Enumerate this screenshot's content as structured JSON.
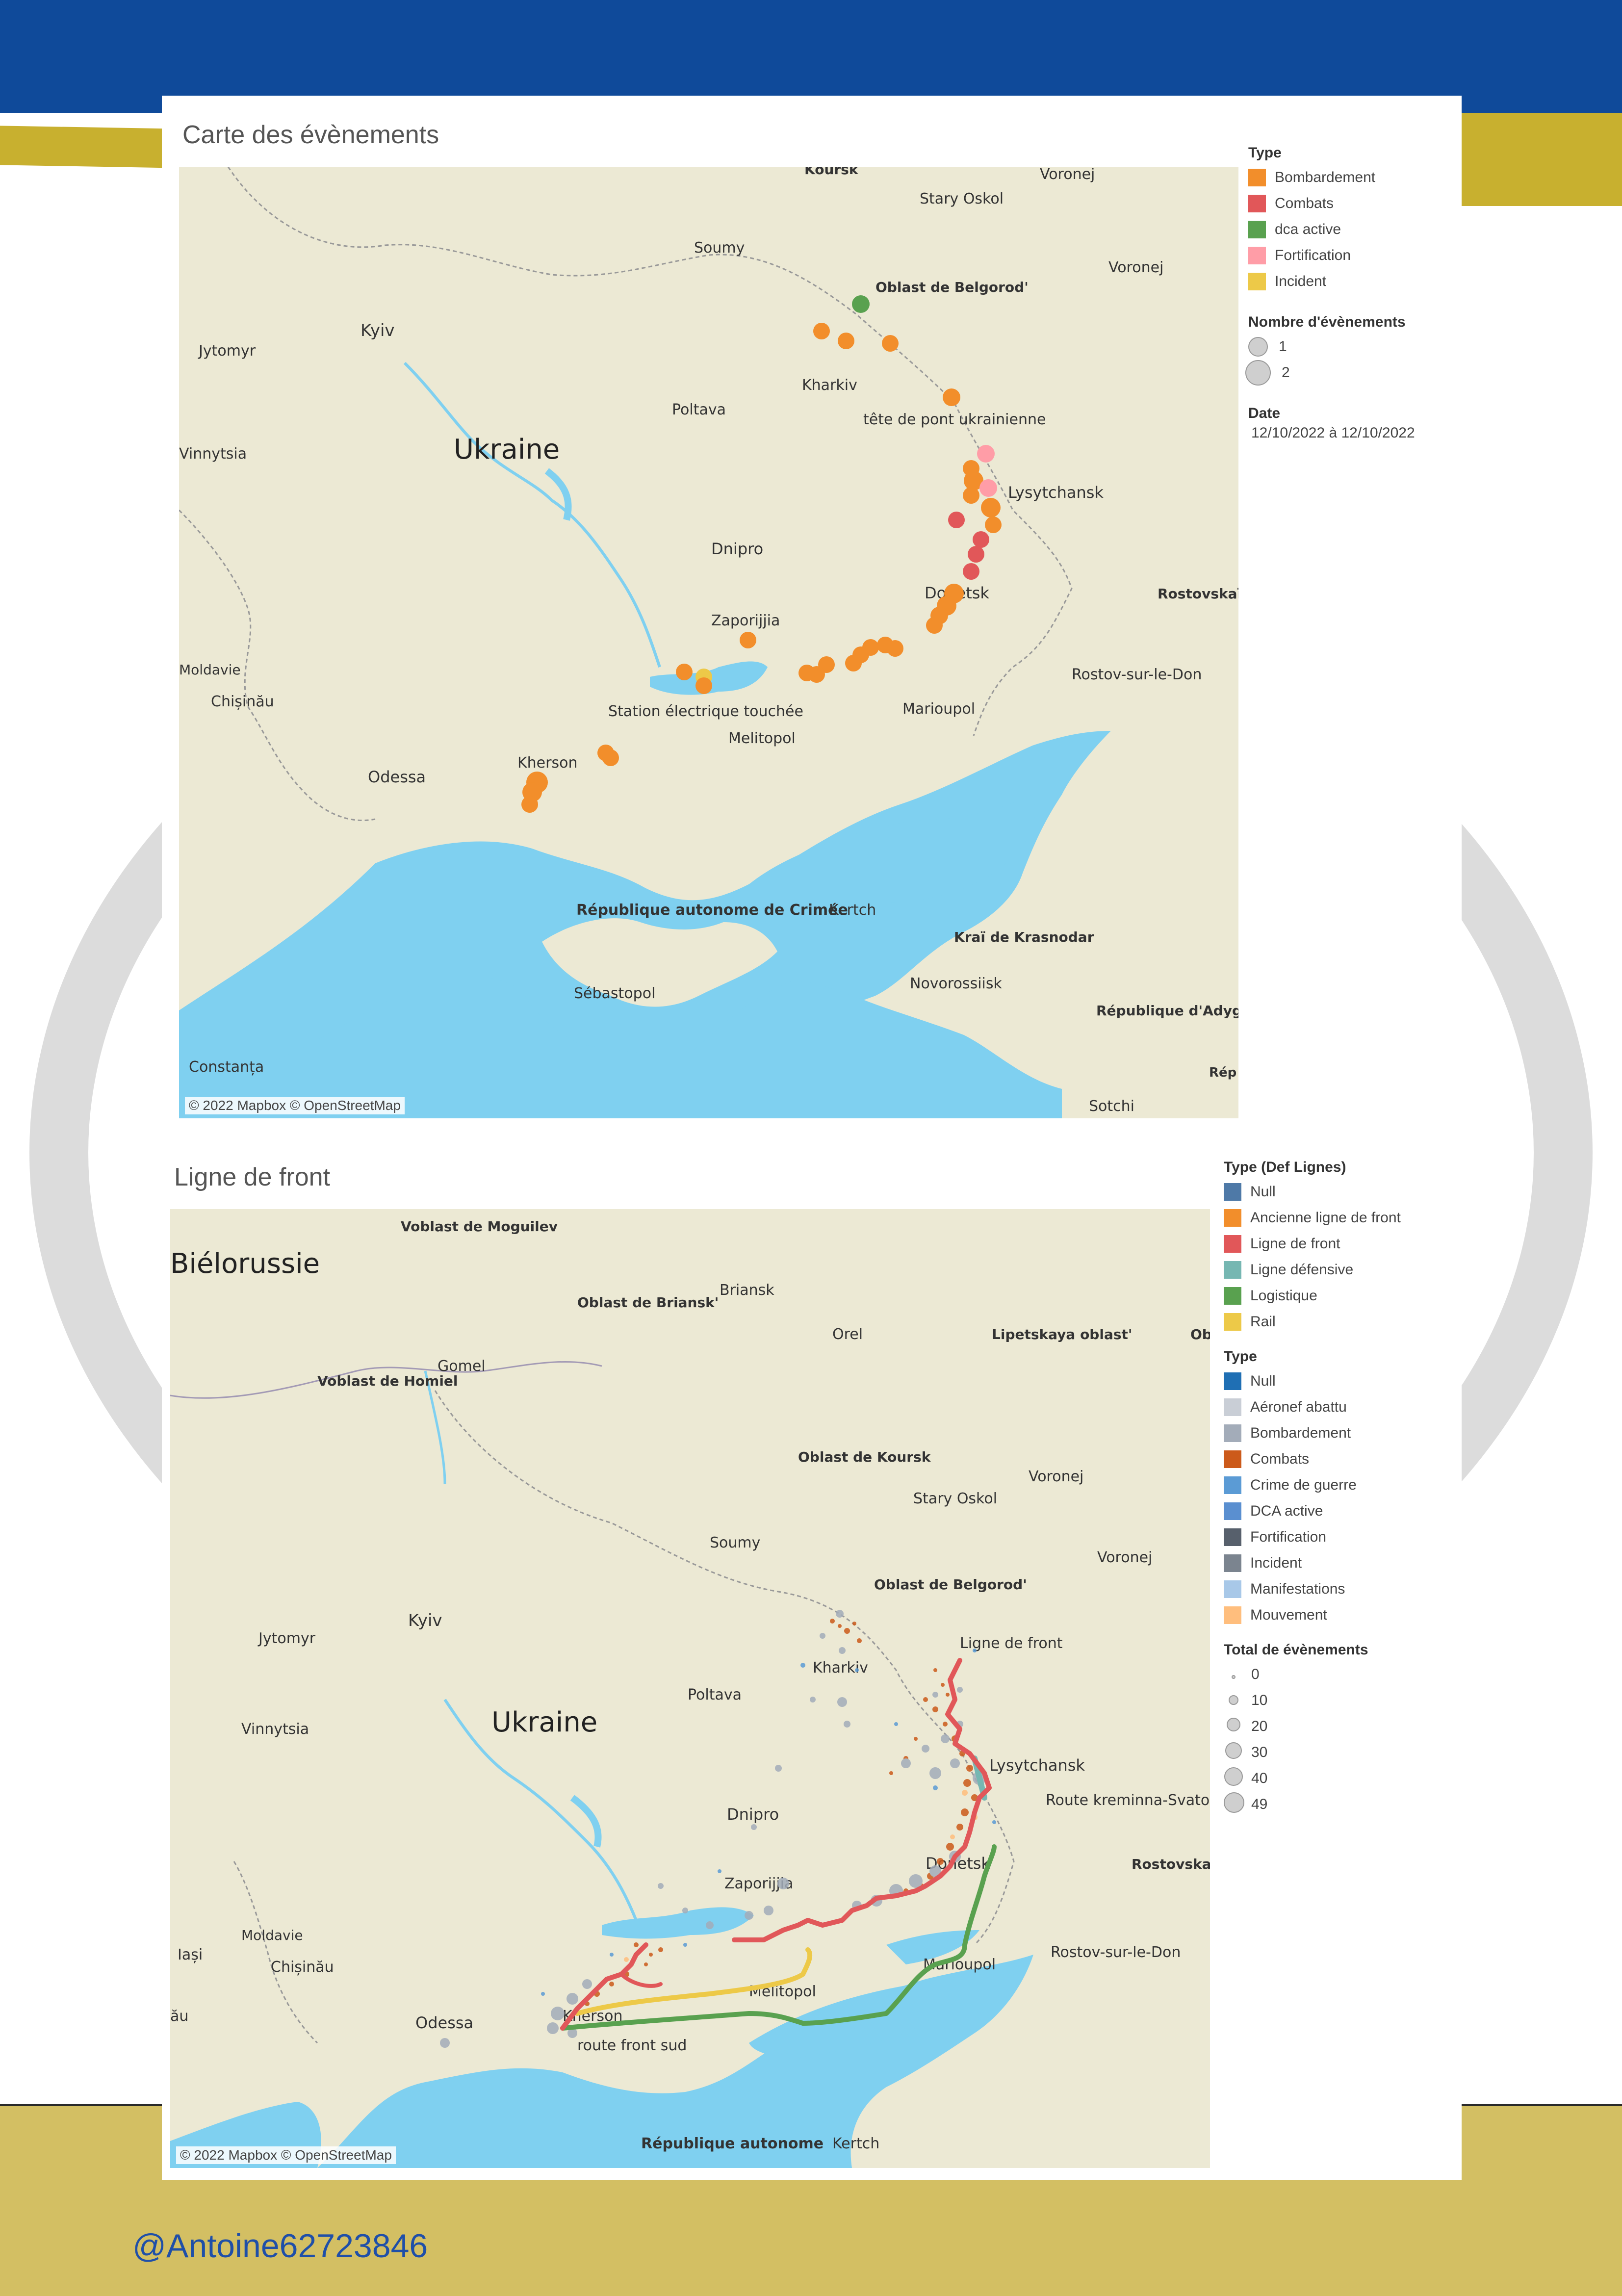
{
  "map1": {
    "title": "Carte des évènements",
    "attribution": "© 2022 Mapbox © OpenStreetMap",
    "places": [
      "Koursk",
      "Stary Oskol",
      "Voronej",
      "Soumy",
      "Oblast de Belgorod'",
      "Jytomyr",
      "Kyiv",
      "Voronej",
      "Kharkiv",
      "Poltava",
      "Vinnytsia",
      "Ukraine",
      "tête de pont ukrainienne",
      "Lysytchansk",
      "Dnipro",
      "Donetsk",
      "Rostovskaïa oblast'",
      "Zaporijjia",
      "Moldavie",
      "Chișinău",
      "Rostov-sur-le-Don",
      "Station électrique touchée",
      "Marioupol",
      "Melitopol",
      "Kherson",
      "Odessa",
      "République autonome de Crimée",
      "Kertch",
      "Kraï de Krasnodar",
      "Novorossiisk",
      "Sébastopol",
      "République d'Adyguée",
      "Constanța",
      "Sotchi",
      "Rép Kar"
    ],
    "legend": {
      "type_title": "Type",
      "types": [
        {
          "label": "Bombardement",
          "color": "#f28e2b"
        },
        {
          "label": "Combats",
          "color": "#e15759"
        },
        {
          "label": "dca active",
          "color": "#59a14f"
        },
        {
          "label": "Fortification",
          "color": "#ff9da7"
        },
        {
          "label": "Incident",
          "color": "#edc948"
        }
      ],
      "count_title": "Nombre d'évènements",
      "counts": [
        "1",
        "2"
      ],
      "date_title": "Date",
      "date_value": "12/10/2022 à 12/10/2022"
    }
  },
  "map2": {
    "title": "Ligne de front",
    "attribution": "© 2022 Mapbox © OpenStreetMap",
    "places": [
      "Voblast de Moguilev",
      "Biélorussie",
      "Briansk",
      "Oblast de Briansk'",
      "Orel",
      "Lipetskaya oblast'",
      "Ob",
      "Voblast de Homiel",
      "Gomel",
      "Oblast de Koursk",
      "Stary Oskol",
      "Voronej",
      "Voronej",
      "Soumy",
      "Oblast de Belgorod'",
      "Jytomyr",
      "Kyiv",
      "Kharkiv",
      "Ligne de front",
      "Poltava",
      "Vinnytsia",
      "Ukraine",
      "Lysytchansk",
      "Route kreminna-Svatove, \"li",
      "Dnipro",
      "Donetsk",
      "Rostovskaïa oblast'",
      "Zaporijjia",
      "Moldavie",
      "Iași",
      "Chișinău",
      "Marioupol",
      "Rostov-sur-le-Don",
      "Melitopol",
      "Kherson",
      "Odessa",
      "route front sud",
      "République autonome",
      "Kertch",
      "ău"
    ],
    "legend": {
      "lines_title": "Type (Def Lignes)",
      "lines": [
        {
          "label": "Null",
          "color": "#4e79a7"
        },
        {
          "label": "Ancienne ligne de front",
          "color": "#f28e2b"
        },
        {
          "label": "Ligne de front",
          "color": "#e15759"
        },
        {
          "label": "Ligne défensive",
          "color": "#76b7b2"
        },
        {
          "label": "Logistique",
          "color": "#59a14f"
        },
        {
          "label": "Rail",
          "color": "#edc948"
        }
      ],
      "type_title": "Type",
      "types": [
        {
          "label": "Null",
          "color": "#1f6fb4"
        },
        {
          "label": "Aéronef abattu",
          "color": "#c9ced6"
        },
        {
          "label": "Bombardement",
          "color": "#a3acb9"
        },
        {
          "label": "Combats",
          "color": "#cc5a1a"
        },
        {
          "label": "Crime de guerre",
          "color": "#5b9bd5"
        },
        {
          "label": "DCA active",
          "color": "#5a8fd0"
        },
        {
          "label": "Fortification",
          "color": "#57606c"
        },
        {
          "label": "Incident",
          "color": "#7b848f"
        },
        {
          "label": "Manifestations",
          "color": "#a8c8e8"
        },
        {
          "label": "Mouvement",
          "color": "#ffbe7d"
        }
      ],
      "total_title": "Total de évènements",
      "totals": [
        "0",
        "10",
        "20",
        "30",
        "40",
        "49"
      ]
    }
  },
  "colors": {
    "water": "#7fd0f0",
    "land": "#ece9d4",
    "header_blue": "#0f4a9a",
    "gold": "#c8b02f"
  },
  "footer": {
    "handle": "@Antoine62723846"
  }
}
